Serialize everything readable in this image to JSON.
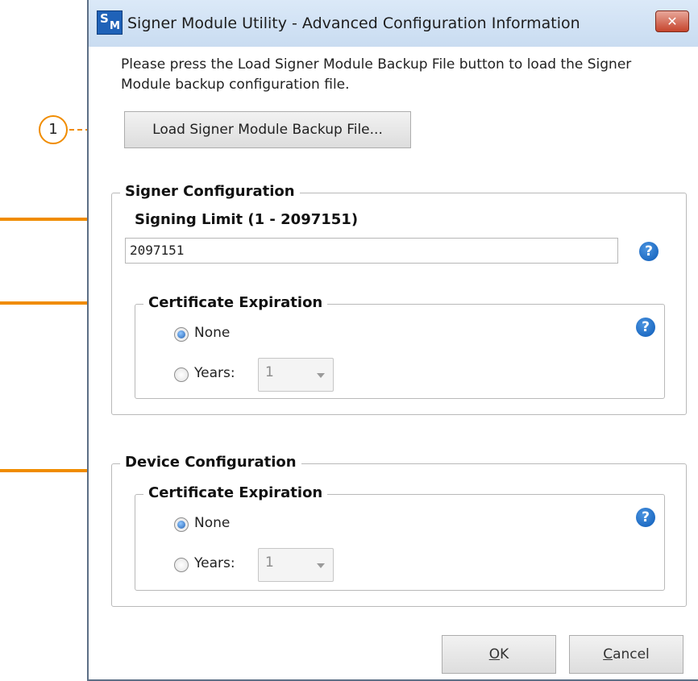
{
  "window": {
    "title": "Signer Module Utility - Advanced Configuration Information",
    "icon_letters": {
      "s": "S",
      "m": "M"
    },
    "close_icon": "✕"
  },
  "instructions": "Please press the Load Signer Module Backup File button to load the Signer Module backup configuration file.",
  "load_button": "Load Signer Module Backup File...",
  "callout_number": "1",
  "signer_config": {
    "title": "Signer Configuration",
    "signing_limit_label": "Signing Limit (1 - 2097151)",
    "signing_limit_value": "2097151",
    "help_icon": "?",
    "cert_expiration": {
      "title": "Certificate Expiration",
      "none_label": "None",
      "years_label": "Years:",
      "years_value": "1",
      "selected": "None"
    }
  },
  "device_config": {
    "title": "Device Configuration",
    "cert_expiration": {
      "title": "Certificate Expiration",
      "none_label": "None",
      "years_label": "Years:",
      "years_value": "1",
      "selected": "None"
    }
  },
  "buttons": {
    "ok": {
      "mnemonic": "O",
      "rest": "K"
    },
    "cancel": {
      "mnemonic": "C",
      "rest": "ancel"
    }
  },
  "colors": {
    "annotation": "#f08c00",
    "help_icon": "#0c5bb8"
  },
  "icons": [
    "app-icon",
    "close-icon",
    "help-icon",
    "radio-icon",
    "dropdown-arrow-icon"
  ]
}
